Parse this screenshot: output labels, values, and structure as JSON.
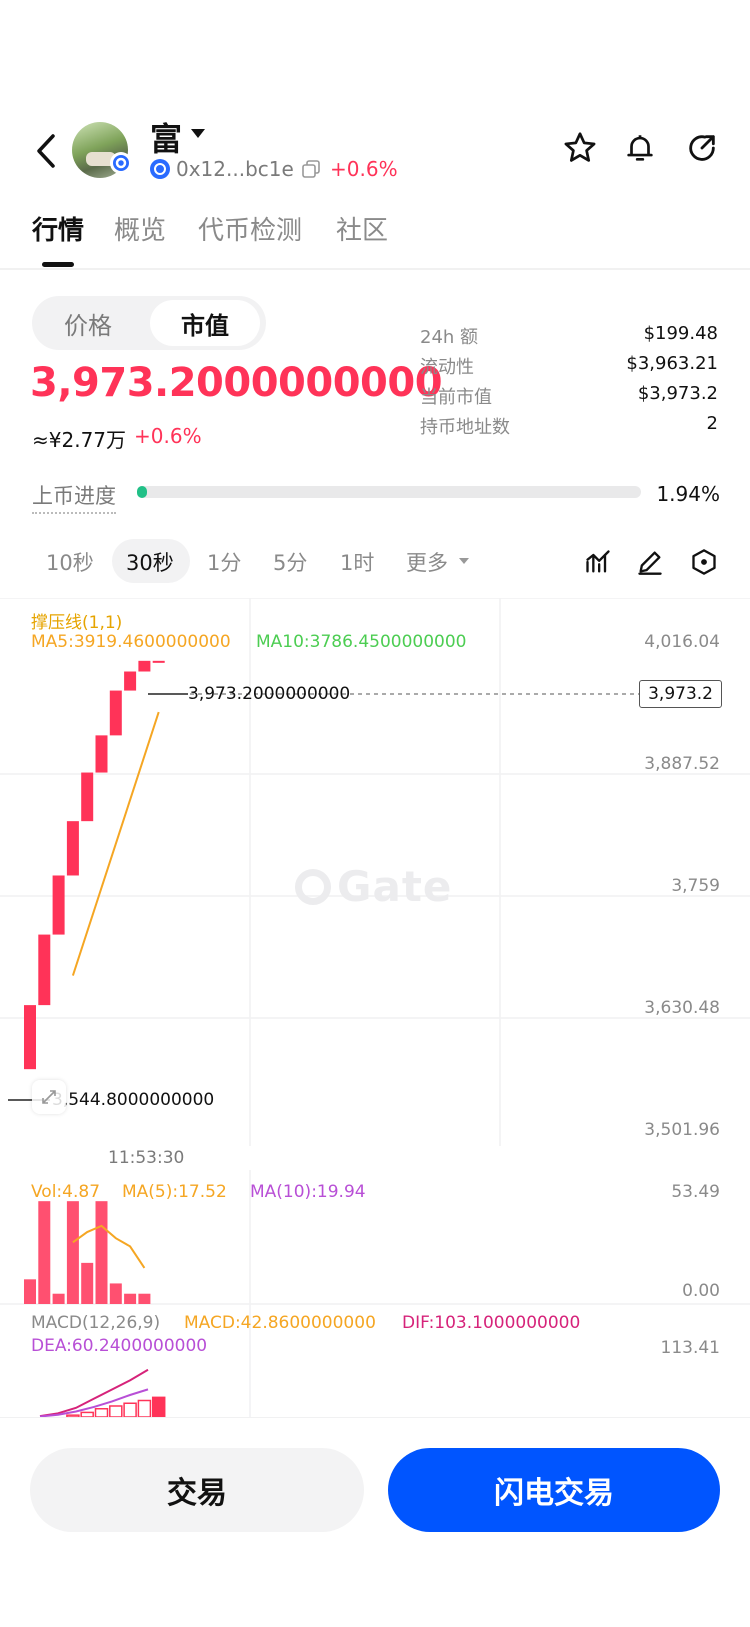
{
  "header": {
    "token_name": "富",
    "address": "0x12...bc1e",
    "change": "+0.6%"
  },
  "tabs": [
    "行情",
    "概览",
    "代币检测",
    "社区"
  ],
  "toggle": {
    "price": "价格",
    "market_cap": "市值"
  },
  "main_value": "3,973.2000000000",
  "sub_value": "≈¥2.77万",
  "sub_change": "+0.6%",
  "stats": [
    {
      "label": "24h  额",
      "value": "$199.48"
    },
    {
      "label": "流动性",
      "value": "$3,963.21"
    },
    {
      "label": "当前市值",
      "value": "$3,973.2"
    },
    {
      "label": "持币地址数",
      "value": "2"
    }
  ],
  "progress": {
    "label": "上币进度",
    "value_text": "1.94%",
    "fraction": 0.0194
  },
  "timeframes": [
    "10秒",
    "30秒",
    "1分",
    "5分",
    "1时",
    "更多"
  ],
  "active_timeframe": 1,
  "chart": {
    "indicator_title": "撑压线(1,1)",
    "ma5": "MA5:3919.4600000000",
    "ma10": "MA10:3786.4500000000",
    "y_ticks": [
      "4,016.04",
      "3,887.52",
      "3,759",
      "3,630.48",
      "3,501.96"
    ],
    "current_price_label": "3,973.2",
    "high_label": "3,973.2000000000",
    "low_label": "3,544.8000000000",
    "time_label": "11:53:30",
    "watermark": "Gate"
  },
  "volume": {
    "vol": "Vol:4.87",
    "ma5": "MA(5):17.52",
    "ma10": "MA(10):19.94",
    "y_top": "53.49",
    "y_bottom": "0.00"
  },
  "macd": {
    "title": "MACD(12,26,9)",
    "macd": "MACD:42.8600000000",
    "dif": "DIF:103.1000000000",
    "dea": "DEA:60.2400000000",
    "y_top": "113.41"
  },
  "chart_data": [
    {
      "type": "candlestick",
      "title": "",
      "y_range": [
        3501.96,
        4016.04
      ],
      "x_label": "11:53:30",
      "candles": [
        {
          "open": 3544.8,
          "close": 3612
        },
        {
          "open": 3612,
          "close": 3686
        },
        {
          "open": 3686,
          "close": 3748
        },
        {
          "open": 3748,
          "close": 3805
        },
        {
          "open": 3805,
          "close": 3856
        },
        {
          "open": 3856,
          "close": 3895
        },
        {
          "open": 3895,
          "close": 3942
        },
        {
          "open": 3942,
          "close": 3962
        },
        {
          "open": 3962,
          "close": 3973.2
        },
        {
          "open": 3973.2,
          "close": 3973.2
        }
      ],
      "ma_line": [
        {
          "i": 3,
          "v": 3643
        },
        {
          "i": 9,
          "v": 3919.46
        }
      ],
      "colors": {
        "up": "#ff3358",
        "ma5": "#f5a623",
        "ma10": "#4ccd52"
      }
    },
    {
      "type": "bar",
      "title": "Vol",
      "y_range": [
        0,
        53.49
      ],
      "values": [
        12,
        50,
        5,
        50,
        20,
        50,
        10,
        5,
        5
      ],
      "ma_line": [
        30,
        35,
        38,
        32,
        28,
        17.52
      ]
    },
    {
      "type": "macd",
      "dif": [
        2,
        8,
        20,
        40,
        60,
        80,
        103.1
      ],
      "dea": [
        1,
        5,
        12,
        22,
        34,
        48,
        60.24
      ],
      "hist": [
        4,
        10,
        18,
        24,
        30,
        36,
        42.86
      ]
    }
  ],
  "buttons": {
    "trade": "交易",
    "flash_trade": "闪电交易"
  },
  "colors": {
    "accent": "#0055ff",
    "up": "#ff3358",
    "progress": "#21c087"
  }
}
